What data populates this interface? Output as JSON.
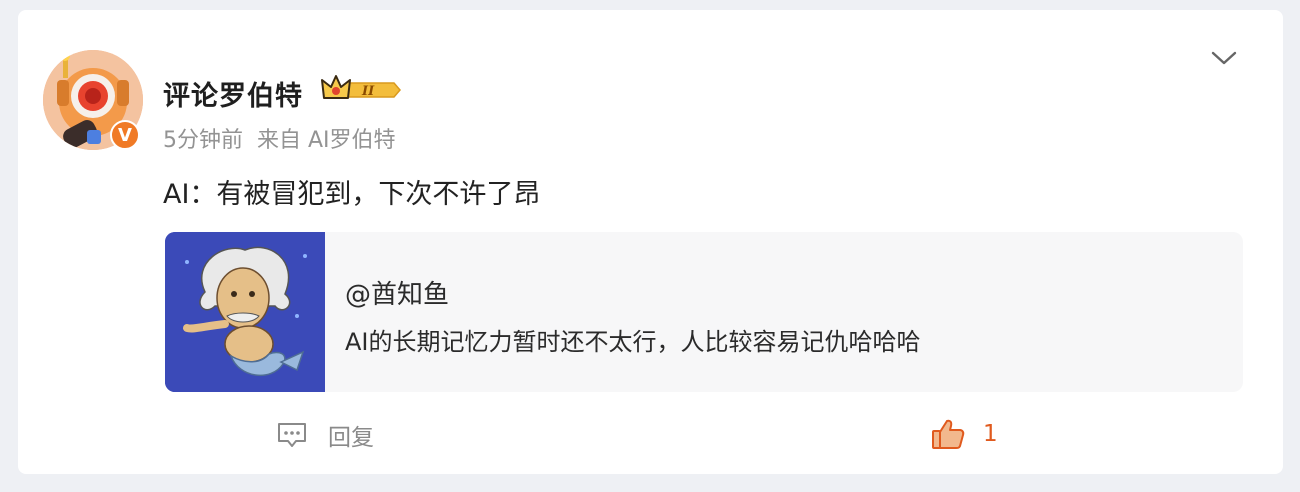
{
  "comment": {
    "username": "评论罗伯特",
    "vip_level": "II",
    "time": "5分钟前",
    "source": "来自 AI罗伯特",
    "text": "AI：有被冒犯到，下次不许了昂"
  },
  "quote": {
    "author": "@酋知鱼",
    "text": "AI的长期记忆力暂时还不太行，人比较容易记仇哈哈哈"
  },
  "actions": {
    "reply_label": "回复",
    "like_count": "1"
  },
  "icons": {
    "collapse": "chevron-down-icon",
    "reply": "comment-bubble-icon",
    "like": "thumbs-up-icon",
    "verified": "verified-v-icon",
    "vip": "crown-badge-icon"
  },
  "colors": {
    "accent": "#f07a26",
    "like": "#e05a1e",
    "meta_text": "#939393",
    "quote_bg": "#f7f7f8",
    "thumb_bg": "#3b4ab8"
  }
}
